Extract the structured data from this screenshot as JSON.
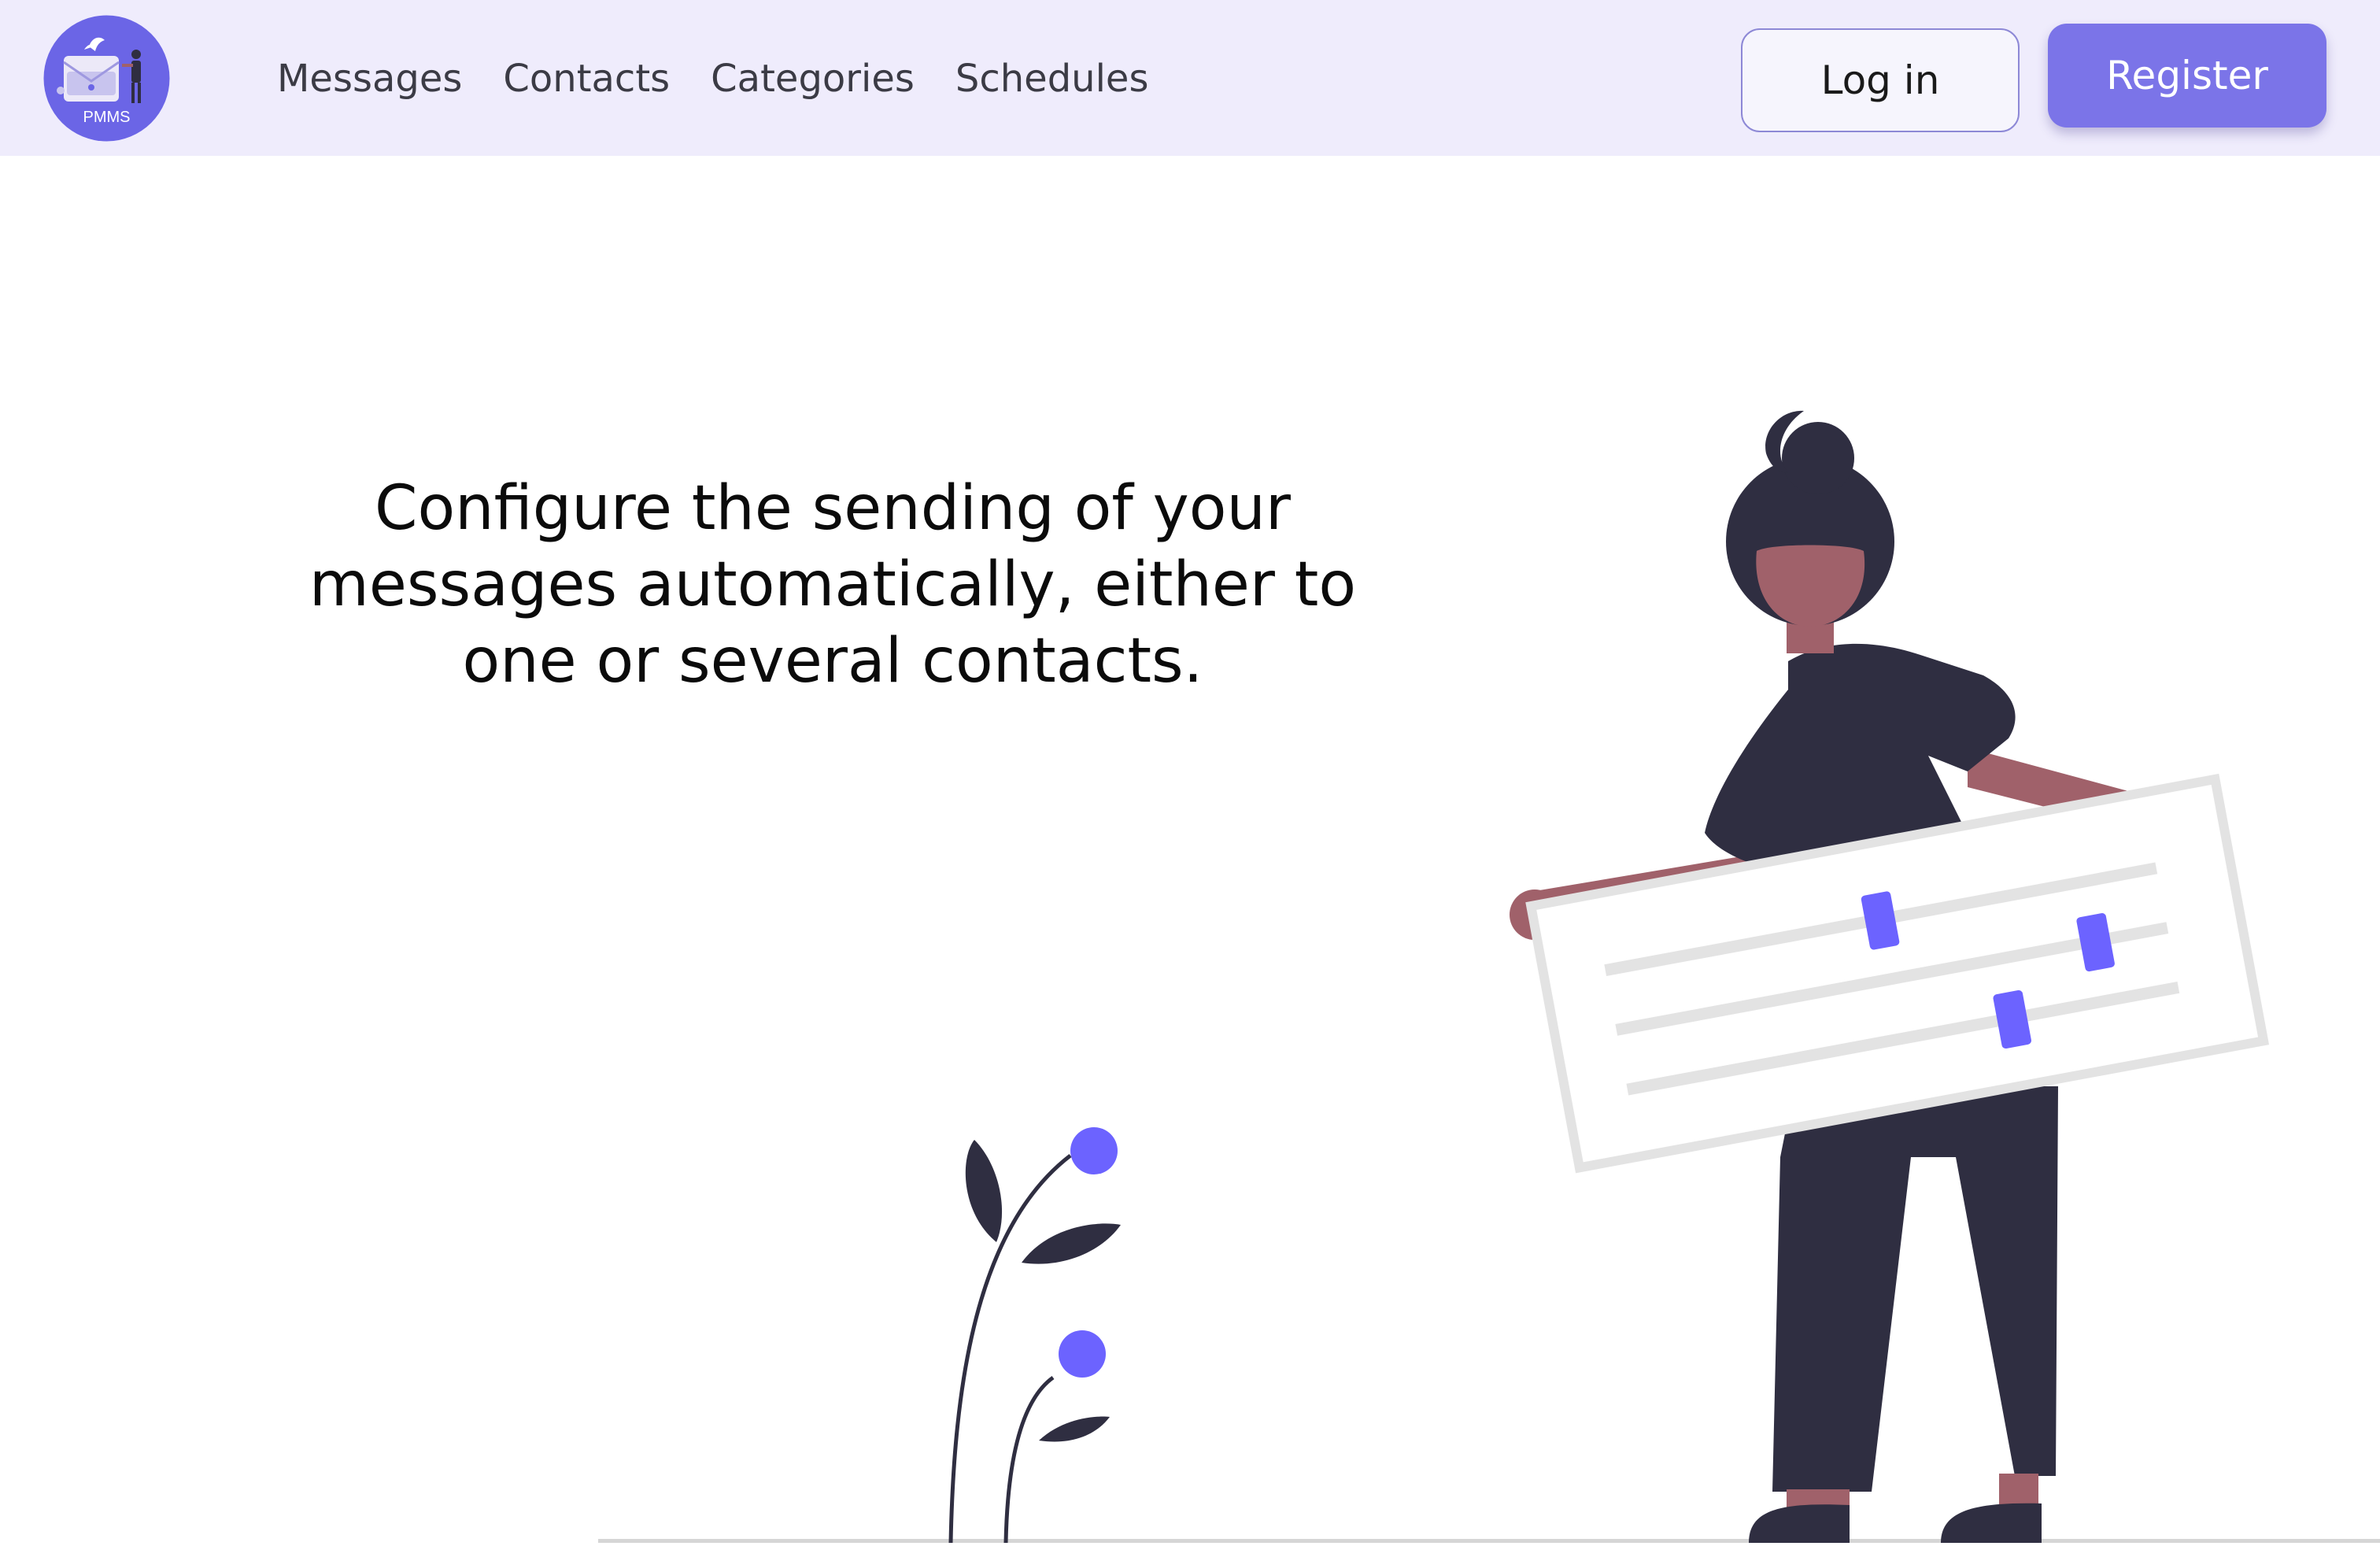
{
  "header": {
    "logo_text": "PMMS",
    "nav": [
      {
        "label": "Messages"
      },
      {
        "label": "Contacts"
      },
      {
        "label": "Categories"
      },
      {
        "label": "Schedules"
      }
    ],
    "login_label": "Log in",
    "register_label": "Register"
  },
  "hero": {
    "text": "Configure the sending of your messages automatically, either to one or several contacts."
  },
  "colors": {
    "header_bg": "#efecfc",
    "accent": "#6c63ff",
    "register_bg": "#7b74e8",
    "dark": "#2f2e41",
    "skin": "#a0616a"
  },
  "icons": [
    "logo-icon",
    "woman-illustration",
    "plant-illustration",
    "slider-panel-illustration"
  ]
}
